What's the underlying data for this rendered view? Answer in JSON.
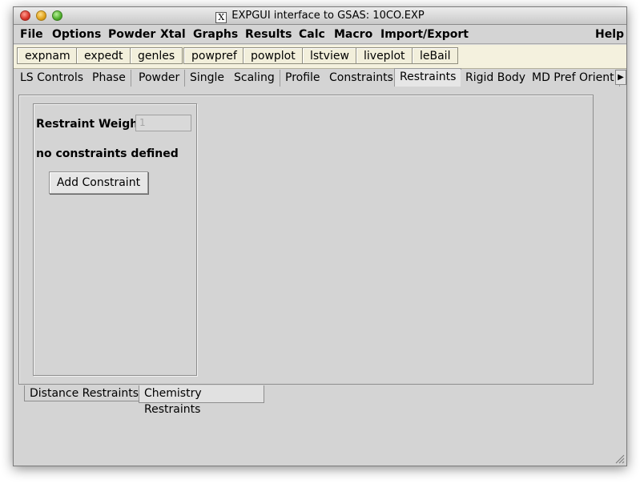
{
  "window": {
    "title": "EXPGUI interface to GSAS: 10CO.EXP",
    "app_icon_letter": "X"
  },
  "menubar": {
    "items": [
      "File",
      "Options",
      "Powder",
      "Xtal",
      "Graphs",
      "Results",
      "Calc",
      "Macro",
      "Import/Export"
    ],
    "help": "Help"
  },
  "toolbar": {
    "buttons": [
      "expnam",
      "expedt",
      "genles",
      "powpref",
      "powplot",
      "lstview",
      "liveplot",
      "leBail"
    ]
  },
  "tabs": {
    "items": [
      "LS Controls",
      "Phase",
      "Powder",
      "Single",
      "Scaling",
      "Profile",
      "Constraints",
      "Restraints",
      "Rigid Body",
      "MD Pref Orient"
    ],
    "active": "Restraints"
  },
  "restraints": {
    "weight_label": "Restraint Weight",
    "weight_value": "1",
    "status_text": "no constraints defined",
    "add_button": "Add Constraint"
  },
  "subtabs": {
    "items": [
      "Distance Restraints",
      "Chemistry Restraints"
    ],
    "active": "Chemistry Restraints"
  },
  "icons": {
    "close": "close-traffic-light-icon",
    "minimize": "minimize-traffic-light-icon",
    "zoom": "zoom-traffic-light-icon",
    "tab_scroll": "triangle-right-icon",
    "resize": "resize-grip-icon"
  }
}
